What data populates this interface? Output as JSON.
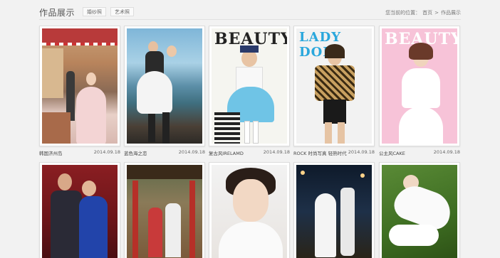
{
  "header": {
    "title": "作品展示",
    "tabs": [
      {
        "label": "婚纱照"
      },
      {
        "label": "艺术照"
      }
    ],
    "breadcrumb": {
      "prefix": "您当前的位置：",
      "home": "首页",
      "sep": ">",
      "current": "作品展示"
    }
  },
  "gallery": {
    "row1": [
      {
        "name": "韩国济州岛",
        "date": "2014.09.18",
        "cover_text": ""
      },
      {
        "name": "蓝色海之恋",
        "date": "2014.09.18",
        "cover_text": ""
      },
      {
        "name": "复古风IRELAMD",
        "date": "2014.09.18",
        "cover_text": "BEAUTY"
      },
      {
        "name": "ROCK 时尚写真 轻熟时代",
        "date": "2014.09.18",
        "cover_text": "LADY DOL"
      },
      {
        "name": "公主风CAKE",
        "date": "2014.09.18",
        "cover_text": "BEAUTY"
      }
    ],
    "row2": [
      {
        "name": "",
        "date": ""
      },
      {
        "name": "",
        "date": ""
      },
      {
        "name": "",
        "date": ""
      },
      {
        "name": "",
        "date": ""
      },
      {
        "name": "",
        "date": ""
      }
    ]
  },
  "colors": {
    "background": "#f2f2f2",
    "frame_border": "#dcdcdc"
  }
}
